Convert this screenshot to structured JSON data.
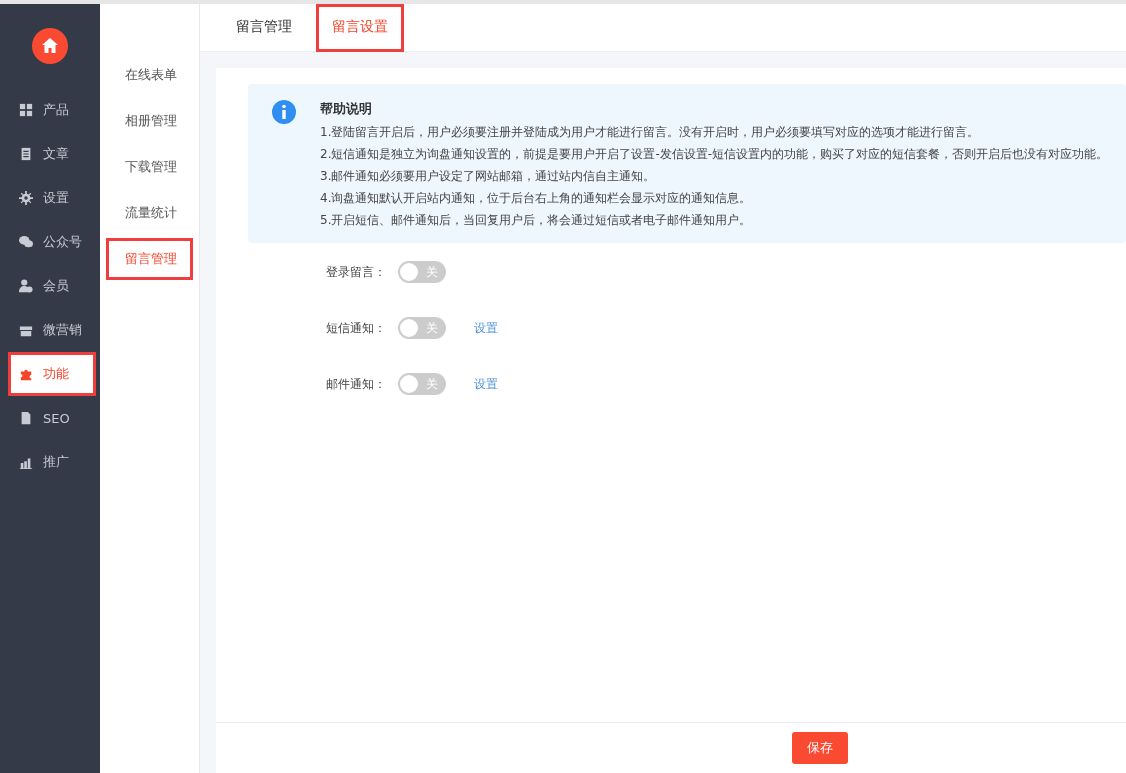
{
  "sidebar": {
    "items": [
      {
        "kind": "grid",
        "label": "产品",
        "selected": false,
        "highlighted": false
      },
      {
        "kind": "doc",
        "label": "文章",
        "selected": false,
        "highlighted": false
      },
      {
        "kind": "gear",
        "label": "设置",
        "selected": false,
        "highlighted": false
      },
      {
        "kind": "chat",
        "label": "公众号",
        "selected": false,
        "highlighted": false
      },
      {
        "kind": "user",
        "label": "会员",
        "selected": false,
        "highlighted": false
      },
      {
        "kind": "gift",
        "label": "微营销",
        "selected": false,
        "highlighted": false
      },
      {
        "kind": "puzzle",
        "label": "功能",
        "selected": true,
        "highlighted": true
      },
      {
        "kind": "file",
        "label": "SEO",
        "selected": false,
        "highlighted": false
      },
      {
        "kind": "chart",
        "label": "推广",
        "selected": false,
        "highlighted": false
      }
    ]
  },
  "submenu": {
    "items": [
      {
        "label": "在线表单",
        "selected": false,
        "highlighted": false
      },
      {
        "label": "相册管理",
        "selected": false,
        "highlighted": false
      },
      {
        "label": "下载管理",
        "selected": false,
        "highlighted": false
      },
      {
        "label": "流量统计",
        "selected": false,
        "highlighted": false
      },
      {
        "label": "留言管理",
        "selected": true,
        "highlighted": true
      }
    ]
  },
  "tabs": [
    {
      "label": "留言管理",
      "selected": false,
      "highlighted": false
    },
    {
      "label": "留言设置",
      "selected": true,
      "highlighted": true
    }
  ],
  "help": {
    "title": "帮助说明",
    "lines": [
      "1.登陆留言开启后，用户必须要注册并登陆成为用户才能进行留言。没有开启时，用户必须要填写对应的选项才能进行留言。",
      "2.短信通知是独立为询盘通知设置的，前提是要用户开启了设置-发信设置-短信设置内的功能，购买了对应的短信套餐，否则开启后也没有对应功能。",
      "3.邮件通知必须要用户设定了网站邮箱，通过站内信自主通知。",
      "4.询盘通知默认开启站内通知，位于后台右上角的通知栏会显示对应的通知信息。",
      "5.开启短信、邮件通知后，当回复用户后，将会通过短信或者电子邮件通知用户。"
    ]
  },
  "settings": [
    {
      "label": "登录留言：",
      "on": false,
      "state_text": "关"
    },
    {
      "label": "短信通知：",
      "on": false,
      "state_text": "关",
      "link": "设置"
    },
    {
      "label": "邮件通知：",
      "on": false,
      "state_text": "关",
      "link": "设置"
    }
  ],
  "save_button": "保存"
}
